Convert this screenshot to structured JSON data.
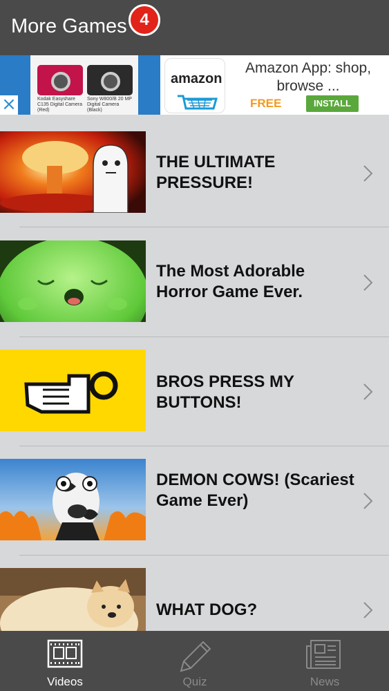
{
  "header": {
    "title": "More Games",
    "badge_count": "4"
  },
  "ad": {
    "close_glyph": "×",
    "product1_caption": "Kodak Easyshare C135 Digital Camera (Red)",
    "product2_caption": "Sony W800/B 20 MP Digital Camera (Black)",
    "brand": "amazon",
    "headline": "Amazon App: shop, browse ...",
    "price": "FREE",
    "install_label": "INSTALL"
  },
  "list": {
    "items": [
      {
        "title": "THE ULTIMATE PRESSURE!",
        "thumbnail": "nuclear-explosion-cartoon"
      },
      {
        "title": "The Most Adorable Horror Game Ever.",
        "thumbnail": "green-creature"
      },
      {
        "title": "BROS PRESS MY BUTTONS!",
        "thumbnail": "pixel-hand-pressing-button"
      },
      {
        "title": "DEMON COWS! (Scariest Game Ever)",
        "thumbnail": "cow-with-fire"
      },
      {
        "title": "WHAT DOG?",
        "thumbnail": "doge-bread"
      }
    ]
  },
  "tabs": [
    {
      "label": "Videos",
      "icon": "film-strip-icon",
      "active": true
    },
    {
      "label": "Quiz",
      "icon": "pencil-icon",
      "active": false
    },
    {
      "label": "News",
      "icon": "newspaper-icon",
      "active": false
    }
  ],
  "colors": {
    "header_bg": "#4a4a4a",
    "badge": "#e2231a",
    "list_bg": "#d7d8da",
    "tab_active": "#ffffff",
    "tab_inactive": "#8a8a8a",
    "install": "#5aa83c",
    "free": "#f39a1e"
  }
}
